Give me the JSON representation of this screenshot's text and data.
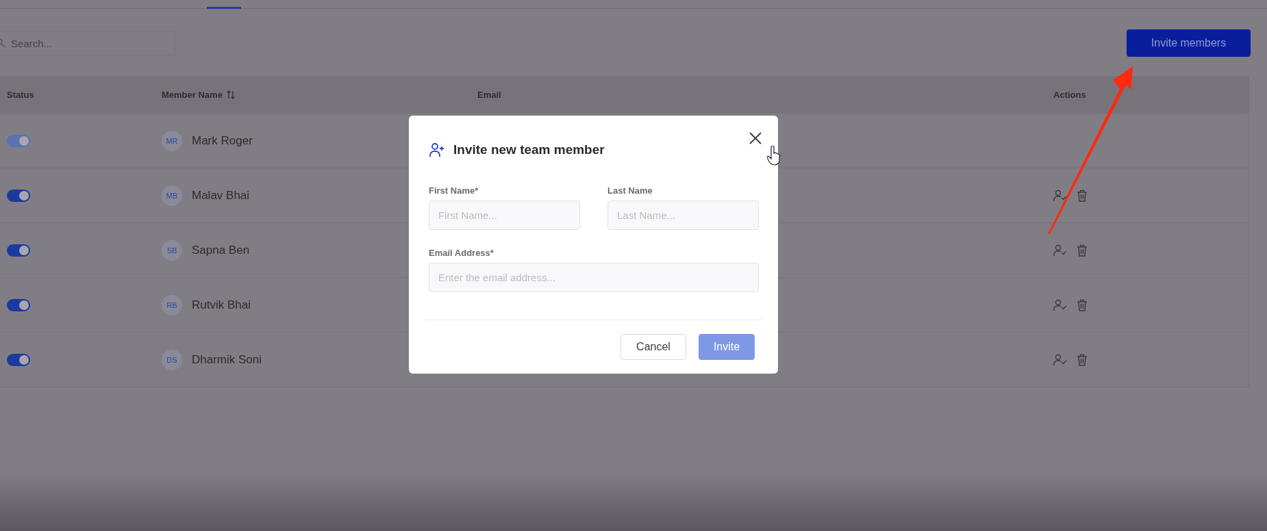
{
  "search": {
    "placeholder": "Search..."
  },
  "invite_button": {
    "label": "Invite members"
  },
  "table": {
    "columns": [
      {
        "label": "Status",
        "sortable": false
      },
      {
        "label": "Member Name",
        "sortable": true
      },
      {
        "label": "Email",
        "sortable": false
      },
      {
        "label": "Actions",
        "sortable": false
      }
    ],
    "rows": [
      {
        "initials": "MR",
        "name": "Mark Roger",
        "on": true,
        "disabled": true,
        "has_actions": false
      },
      {
        "initials": "MB",
        "name": "Malav Bhai",
        "on": true,
        "disabled": false,
        "has_actions": true
      },
      {
        "initials": "SB",
        "name": "Sapna Ben",
        "on": true,
        "disabled": false,
        "has_actions": true
      },
      {
        "initials": "RB",
        "name": "Rutvik Bhai",
        "on": true,
        "disabled": false,
        "has_actions": true
      },
      {
        "initials": "DS",
        "name": "Dharmik Soni",
        "on": true,
        "disabled": false,
        "has_actions": true
      }
    ]
  },
  "dialog": {
    "title": "Invite new team member",
    "fields": [
      {
        "kind": "half",
        "label": "First Name*",
        "placeholder": "First Name..."
      },
      {
        "kind": "half",
        "label": "Last Name",
        "placeholder": "Last Name..."
      },
      {
        "kind": "full",
        "label": "Email Address*",
        "placeholder": "Enter the email address..."
      }
    ],
    "buttons": [
      {
        "kind": "secondary",
        "label": "Cancel",
        "disabled": false
      },
      {
        "kind": "primary",
        "label": "Invite",
        "disabled": true
      }
    ]
  }
}
